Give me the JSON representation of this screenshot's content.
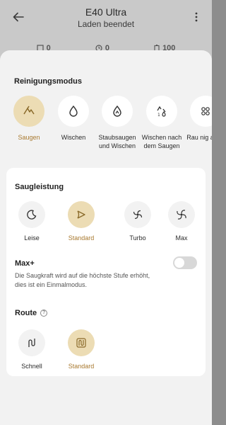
{
  "header": {
    "title": "E40 Ultra",
    "subtitle": "Laden beendet"
  },
  "stats": [
    {
      "icon": "area-icon",
      "value": "0"
    },
    {
      "icon": "clock-icon",
      "value": "0"
    },
    {
      "icon": "battery-icon",
      "value": "100"
    }
  ],
  "cleaning_mode": {
    "title": "Reinigungsmodus",
    "items": [
      {
        "label": "Saugen",
        "icon": "vacuum-icon",
        "selected": true
      },
      {
        "label": "Wischen",
        "icon": "mop-icon",
        "selected": false
      },
      {
        "label": "Staubsaugen und Wischen",
        "icon": "vacuum-mop-icon",
        "selected": false
      },
      {
        "label": "Wischen nach dem Saugen",
        "icon": "mop-after-vacuum-icon",
        "selected": false
      },
      {
        "label": "Rau nig anpa",
        "icon": "custom-icon",
        "selected": false
      }
    ]
  },
  "suction": {
    "title": "Saugleistung",
    "items": [
      {
        "label": "Leise",
        "icon": "quiet-icon",
        "selected": false
      },
      {
        "label": "Standard",
        "icon": "standard-fan-icon",
        "selected": true
      },
      {
        "label": "Turbo",
        "icon": "turbo-fan-icon",
        "selected": false
      },
      {
        "label": "Max",
        "icon": "max-fan-icon",
        "selected": false
      }
    ]
  },
  "max_plus": {
    "title": "Max+",
    "description": "Die Saugkraft wird auf die höchste Stufe erhöht, dies ist ein Einmalmodus.",
    "enabled": false
  },
  "route": {
    "title": "Route",
    "items": [
      {
        "label": "Schnell",
        "icon": "quick-route-icon",
        "selected": false
      },
      {
        "label": "Standard",
        "icon": "standard-route-icon",
        "selected": true
      }
    ]
  },
  "colors": {
    "accent": "#a8792f",
    "selected_bg": "#ecdcb4",
    "sheet_bg": "#f2f2f2",
    "card_bg": "#ffffff"
  }
}
